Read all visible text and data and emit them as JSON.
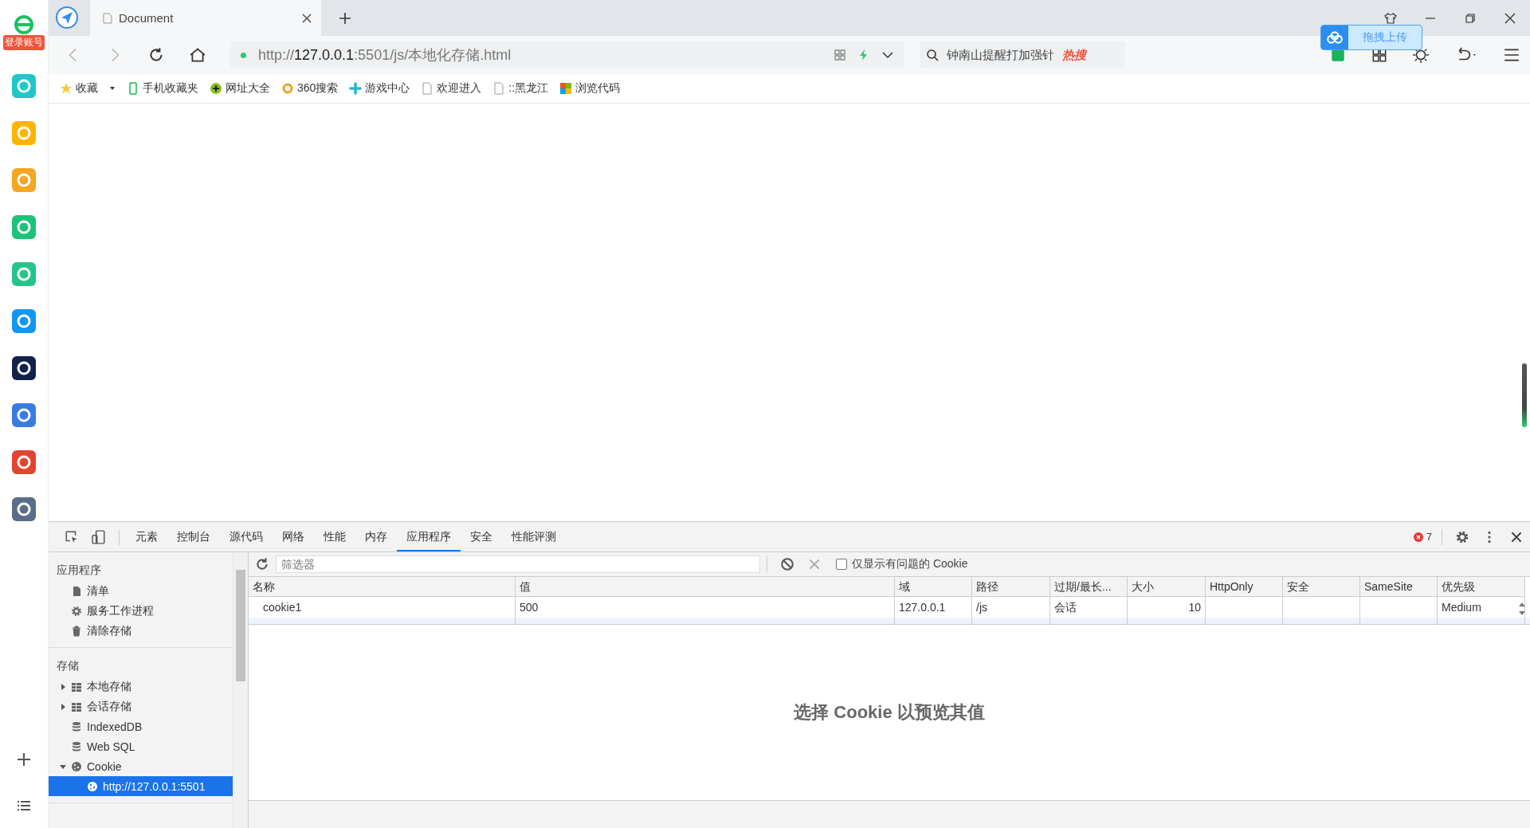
{
  "sidebar": {
    "login_badge": "登录账号",
    "apps": [
      {
        "color": "#1fc8c8"
      },
      {
        "color": "#ffb400"
      },
      {
        "color": "#f5a623"
      },
      {
        "color": "#1ec27a"
      },
      {
        "color": "#27c48a"
      },
      {
        "color": "#1296f0"
      },
      {
        "color": "#13204a"
      },
      {
        "color": "#3a7be0"
      },
      {
        "color": "#e2452f"
      },
      {
        "color": "#5a6d8a"
      }
    ]
  },
  "browser_tabs": [
    {
      "title": "Document",
      "selected": true
    }
  ],
  "address_bar": {
    "scheme": "http://",
    "host": "127.0.0.1",
    "rest": ":5501/js/本地化存储.html"
  },
  "search": {
    "value": "钟南山提醒打加强针",
    "badge": "热搜"
  },
  "cloud_upload": "拖拽上传",
  "bookmarks": [
    {
      "label": "收藏",
      "kind": "star"
    },
    {
      "label": "手机收藏夹",
      "kind": "phone"
    },
    {
      "label": "网址大全",
      "kind": "plus"
    },
    {
      "label": "360搜索",
      "kind": "ring"
    },
    {
      "label": "游戏中心",
      "kind": "game"
    },
    {
      "label": "欢迎进入",
      "kind": "page"
    },
    {
      "label": "::黑龙江",
      "kind": "page"
    },
    {
      "label": "浏览代码",
      "kind": "tiles"
    }
  ],
  "devtools": {
    "tabs": [
      {
        "label": "元素",
        "selected": false
      },
      {
        "label": "控制台",
        "selected": false
      },
      {
        "label": "源代码",
        "selected": false
      },
      {
        "label": "网络",
        "selected": false
      },
      {
        "label": "性能",
        "selected": false
      },
      {
        "label": "内存",
        "selected": false
      },
      {
        "label": "应用程序",
        "selected": true
      },
      {
        "label": "安全",
        "selected": false
      },
      {
        "label": "性能评测",
        "selected": false
      }
    ],
    "error_count": "7",
    "sections": [
      {
        "title": "应用程序",
        "items": [
          {
            "label": "清单",
            "kind": "file"
          },
          {
            "label": "服务工作进程",
            "kind": "gear"
          },
          {
            "label": "清除存储",
            "kind": "trash"
          }
        ]
      },
      {
        "title": "存储",
        "items": [
          {
            "label": "本地存储",
            "kind": "table",
            "expanded": false,
            "selected": false
          },
          {
            "label": "会话存储",
            "kind": "table",
            "expanded": false,
            "selected": false
          },
          {
            "label": "IndexedDB",
            "kind": "db",
            "selected": false
          },
          {
            "label": "Web SQL",
            "kind": "db",
            "selected": false
          },
          {
            "label": "Cookie",
            "kind": "cookie",
            "expanded": true,
            "selected": false,
            "children": [
              {
                "label": "http://127.0.0.1:5501",
                "kind": "cookie",
                "selected": true
              }
            ]
          }
        ]
      }
    ],
    "filter": {
      "placeholder": "筛选器"
    },
    "only_issues": {
      "label": "仅显示有问题的 Cookie",
      "checked": false
    },
    "table": {
      "columns": [
        "名称",
        "值",
        "域",
        "路径",
        "过期/最长...",
        "大小",
        "HttpOnly",
        "安全",
        "SameSite",
        "优先级"
      ],
      "rows": [
        [
          "cookie1",
          "500",
          "127.0.0.1",
          "/js",
          "会话",
          "10",
          "",
          "",
          "",
          "Medium"
        ]
      ]
    },
    "preview_hint": "选择 Cookie 以预览其值"
  }
}
